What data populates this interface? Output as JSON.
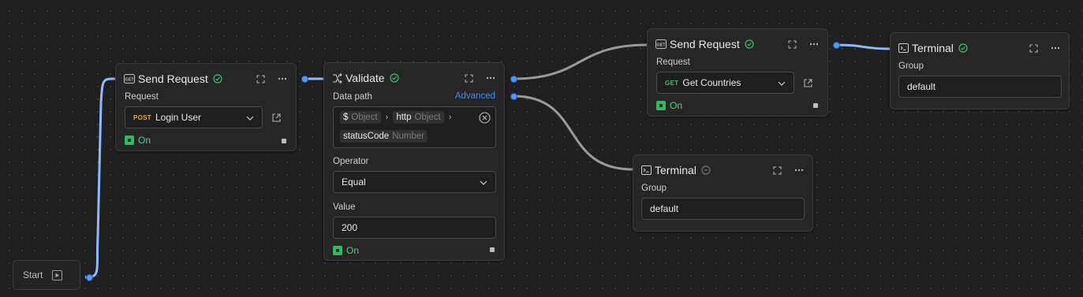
{
  "start": {
    "label": "Start"
  },
  "login_request": {
    "title": "Send Request",
    "request_label": "Request",
    "method": "POST",
    "request_value": "Login User",
    "status": "On"
  },
  "validate": {
    "title": "Validate",
    "data_path_label": "Data path",
    "advanced_label": "Advanced",
    "path_tokens": [
      {
        "name": "$",
        "type": "Object"
      },
      {
        "name": "http",
        "type": "Object"
      },
      {
        "name": "statusCode",
        "type": "Number"
      }
    ],
    "operator_label": "Operator",
    "operator_value": "Equal",
    "value_label": "Value",
    "value": "200",
    "status": "On"
  },
  "countries_request": {
    "title": "Send Request",
    "request_label": "Request",
    "method": "GET",
    "request_value": "Get Countries",
    "status": "On"
  },
  "terminal_top": {
    "title": "Terminal",
    "group_label": "Group",
    "group_value": "default"
  },
  "terminal_bottom": {
    "title": "Terminal",
    "group_label": "Group",
    "group_value": "default"
  },
  "colors": {
    "background": "#1f1f1f",
    "node_bg": "#262626",
    "active_edge": "#8fb9ff",
    "inactive_edge": "#9a9a9a",
    "on_green": "#4ed37c",
    "link_blue": "#3d8bfd",
    "post_orange": "#f0a640"
  }
}
